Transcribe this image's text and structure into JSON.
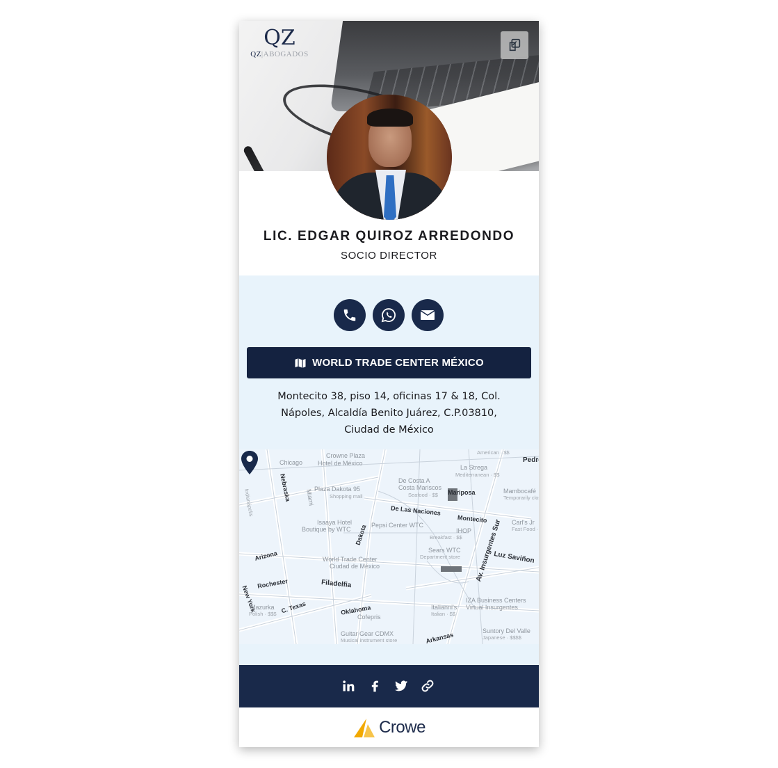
{
  "header": {
    "logo_mark": "QZ",
    "logo_left": "QZ",
    "logo_right": "ABOGADOS",
    "share_icon": "copy-icon"
  },
  "profile": {
    "name": "LIC. EDGAR QUIROZ ARREDONDO",
    "title": "SOCIO DIRECTOR"
  },
  "contact": {
    "buttons": [
      {
        "icon": "phone-icon"
      },
      {
        "icon": "whatsapp-icon"
      },
      {
        "icon": "envelope-icon"
      }
    ],
    "location_label": "WORLD TRADE CENTER MÉXICO",
    "address_lines": [
      "Montecito 38, piso 14, oficinas 17 & 18, Col.",
      "Nápoles, Alcaldía Benito Juárez, C.P.03810,",
      "Ciudad de México"
    ]
  },
  "map": {
    "places": [
      {
        "name": "Crowne Plaza"
      },
      {
        "name": "Hotel de México"
      },
      {
        "name": "Chicago"
      },
      {
        "name": "Nebraska"
      },
      {
        "name": "Indianápolis"
      },
      {
        "name": "Miami"
      },
      {
        "name": "Plaza Dakota 95"
      },
      {
        "name": "Shopping mall"
      },
      {
        "name": "De Costa A"
      },
      {
        "name": "Costa Mariscos"
      },
      {
        "name": "Seafood · $$"
      },
      {
        "name": "Mariposa"
      },
      {
        "name": "La Strega"
      },
      {
        "name": "Mediterranean · $$"
      },
      {
        "name": "Mambocafé"
      },
      {
        "name": "Temporarily closed"
      },
      {
        "name": "De Las Naciones"
      },
      {
        "name": "Montecito"
      },
      {
        "name": "Isaaya Hotel"
      },
      {
        "name": "Boutique by WTC"
      },
      {
        "name": "Pepsi Center WTC"
      },
      {
        "name": "IHOP"
      },
      {
        "name": "Breakfast · $$"
      },
      {
        "name": "Carl's Jr"
      },
      {
        "name": "Fast Food · $"
      },
      {
        "name": "Dakota"
      },
      {
        "name": "Arizona"
      },
      {
        "name": "World Trade Center"
      },
      {
        "name": "Ciudad de México"
      },
      {
        "name": "Sears WTC"
      },
      {
        "name": "Department store"
      },
      {
        "name": "Av. Insurgentes Sur"
      },
      {
        "name": "Luz Saviñon"
      },
      {
        "name": "Rochester"
      },
      {
        "name": "Filadelfia"
      },
      {
        "name": "New York"
      },
      {
        "name": "Mazurka"
      },
      {
        "name": "Polish · $$$"
      },
      {
        "name": "C. Texas"
      },
      {
        "name": "Oklahoma"
      },
      {
        "name": "Cofepris"
      },
      {
        "name": "IZA Business Centers"
      },
      {
        "name": "Virtual Insurgentes"
      },
      {
        "name": "Italianni's"
      },
      {
        "name": "Italian · $$"
      },
      {
        "name": "Guitar Gear CDMX"
      },
      {
        "name": "Musical instrument store"
      },
      {
        "name": "Arkansas"
      },
      {
        "name": "Suntory Del Valle"
      },
      {
        "name": "Japanese · $$$$"
      },
      {
        "name": "Pedro"
      },
      {
        "name": "American · $$"
      }
    ]
  },
  "social": {
    "icons": [
      "linkedin-icon",
      "facebook-icon",
      "twitter-icon",
      "link-icon"
    ]
  },
  "footer": {
    "brand": "Crowe"
  },
  "colors": {
    "navy": "#19294a",
    "light_blue_bg": "#e8f3fb",
    "crowe_gold": "#f2a900"
  }
}
